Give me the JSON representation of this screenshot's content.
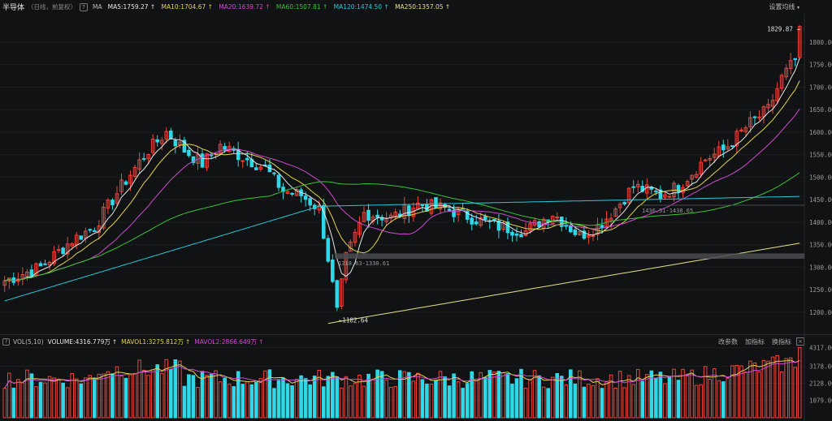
{
  "header": {
    "title": "半导体",
    "subtitle": "（日线，前复权）",
    "help": "?",
    "ma_label": "MA",
    "ma_items": [
      {
        "text": "MA5:1759.27",
        "color": "#e8e8e8",
        "arrow": "↑"
      },
      {
        "text": "MA10:1704.67",
        "color": "#e3d54a",
        "arrow": "↑"
      },
      {
        "text": "MA20:1639.72",
        "color": "#d04ad0",
        "arrow": "↑"
      },
      {
        "text": "MA60:1507.81",
        "color": "#37c437",
        "arrow": "↑"
      },
      {
        "text": "MA120:1474.50",
        "color": "#27c8d8",
        "arrow": "↑"
      },
      {
        "text": "MA250:1357.05",
        "color": "#e8e08a",
        "arrow": "↑"
      }
    ],
    "settings_label": "设置均线",
    "settings_caret": "▾"
  },
  "volume_header": {
    "help": "?",
    "label": "VOL(5,10)",
    "items": [
      {
        "text": "VOLUME:4316.779万",
        "color": "#e8e8e8",
        "arrow": "↑"
      },
      {
        "text": "MAVOL1:3275.812万",
        "color": "#e3d54a",
        "arrow": "↑"
      },
      {
        "text": "MAVOL2:2866.649万",
        "color": "#d04ad0",
        "arrow": "↑"
      }
    ],
    "tools": [
      "改参数",
      "加指标",
      "换指标"
    ],
    "close": "×"
  },
  "annotations": {
    "high": "1829.87",
    "low": "1182.64",
    "range_low": "1318.63-1330.61",
    "range_mid": "1436.51-1438.65"
  },
  "colors": {
    "up": "#f0443c",
    "down": "#2fd8e6",
    "background": "#111214",
    "grid": "#1c1d20"
  },
  "chart_data": [
    {
      "type": "candlestick",
      "title": "",
      "yaxis_ticks": [
        1200,
        1250,
        1300,
        1350,
        1400,
        1450,
        1500,
        1550,
        1600,
        1650,
        1700,
        1750,
        1800
      ],
      "yaxis_tick_labels": [
        "1200.00",
        "1250.00",
        "1300.00",
        "1350.00",
        "1400.00",
        "1450.00",
        "1500.00",
        "1550.00",
        "1600.00",
        "1650.00",
        "1700.00",
        "1750.00",
        "1800.00"
      ],
      "ylim": [
        1160,
        1845
      ],
      "series": [
        {
          "name": "MA5",
          "value": 1759.27
        },
        {
          "name": "MA10",
          "value": 1704.67
        },
        {
          "name": "MA20",
          "value": 1639.72
        },
        {
          "name": "MA60",
          "value": 1507.81
        },
        {
          "name": "MA120",
          "value": 1474.5
        },
        {
          "name": "MA250",
          "value": 1357.05
        }
      ],
      "high": 1829.87,
      "low": 1182.64
    },
    {
      "type": "bar",
      "title": "",
      "yaxis_tick_labels": [
        "4317.00",
        "3178.00",
        "2128.00",
        "1079.00"
      ],
      "yaxis_ticks": [
        4317,
        3178,
        2128,
        1079
      ],
      "ylim": [
        0,
        4400
      ],
      "series": [
        {
          "name": "VOLUME",
          "value": 4316.779
        },
        {
          "name": "MAVOL1",
          "value": 3275.812
        },
        {
          "name": "MAVOL2",
          "value": 2866.649
        }
      ]
    }
  ]
}
